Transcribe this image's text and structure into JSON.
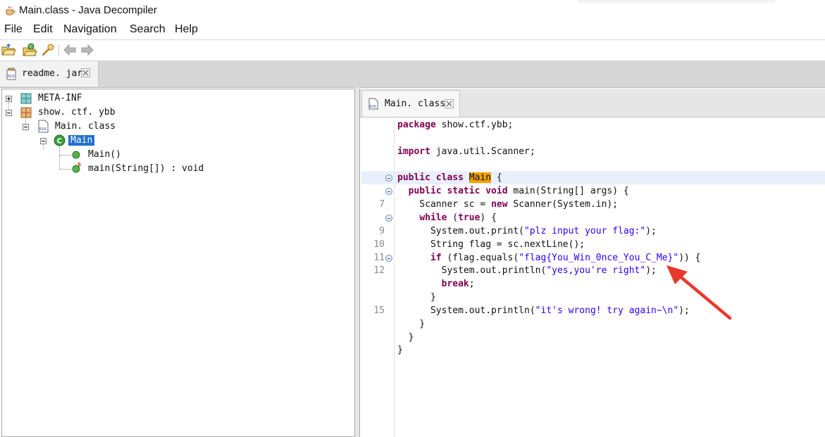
{
  "window": {
    "title": "Main.class - Java Decompiler"
  },
  "menu": [
    "File",
    "Edit",
    "Navigation",
    "Search",
    "Help"
  ],
  "toolbar": {
    "buttons": [
      "open-file-icon",
      "open-type-icon",
      "search-icon",
      "back-arrow-icon",
      "forward-arrow-icon"
    ]
  },
  "outer_tab": {
    "label": "readme. jar"
  },
  "tree": {
    "nodes": [
      {
        "label": "META-INF",
        "icon": "package-icon"
      },
      {
        "label": "show. ctf. ybb",
        "icon": "package-icon"
      },
      {
        "label": "Main. class",
        "icon": "class-file-icon"
      },
      {
        "label": "Main",
        "icon": "class-icon"
      },
      {
        "label": "Main()",
        "icon": "method-icon"
      },
      {
        "label": "main(String[]) : void",
        "icon": "static-method-icon"
      }
    ]
  },
  "editor": {
    "tab_label": "Main. class",
    "lines": [
      {
        "num": "",
        "fold": false,
        "current": false,
        "parts": [
          [
            "k",
            "package"
          ],
          [
            "t",
            " show.ctf.ybb;"
          ]
        ]
      },
      {
        "num": "",
        "fold": false,
        "current": false,
        "parts": []
      },
      {
        "num": "",
        "fold": false,
        "current": false,
        "parts": [
          [
            "k",
            "import"
          ],
          [
            "t",
            " java.util.Scanner;"
          ]
        ]
      },
      {
        "num": "",
        "fold": false,
        "current": false,
        "parts": []
      },
      {
        "num": "",
        "fold": true,
        "current": true,
        "parts": [
          [
            "k",
            "public class"
          ],
          [
            "t",
            " "
          ],
          [
            "h",
            "Main"
          ],
          [
            "t",
            " {"
          ]
        ]
      },
      {
        "num": "",
        "fold": true,
        "current": false,
        "parts": [
          [
            "t",
            "  "
          ],
          [
            "k",
            "public static void"
          ],
          [
            "t",
            " main(String[] args) {"
          ]
        ]
      },
      {
        "num": "7",
        "fold": false,
        "current": false,
        "parts": [
          [
            "t",
            "    Scanner sc = "
          ],
          [
            "k",
            "new"
          ],
          [
            "t",
            " Scanner(System.in);"
          ]
        ]
      },
      {
        "num": "",
        "fold": true,
        "current": false,
        "parts": [
          [
            "t",
            "    "
          ],
          [
            "k",
            "while"
          ],
          [
            "t",
            " ("
          ],
          [
            "k",
            "true"
          ],
          [
            "t",
            ") {"
          ]
        ]
      },
      {
        "num": "9",
        "fold": false,
        "current": false,
        "parts": [
          [
            "t",
            "      System.out.print("
          ],
          [
            "s",
            "\"plz input your flag:\""
          ],
          [
            "t",
            ");"
          ]
        ]
      },
      {
        "num": "10",
        "fold": false,
        "current": false,
        "parts": [
          [
            "t",
            "      String flag = sc.nextLine();"
          ]
        ]
      },
      {
        "num": "11",
        "fold": true,
        "current": false,
        "parts": [
          [
            "t",
            "      "
          ],
          [
            "k",
            "if"
          ],
          [
            "t",
            " (flag.equals("
          ],
          [
            "s",
            "\"flag{You_Win_0nce_You_C_Me}\""
          ],
          [
            "t",
            ")) {"
          ]
        ]
      },
      {
        "num": "12",
        "fold": false,
        "current": false,
        "parts": [
          [
            "t",
            "        System.out.println("
          ],
          [
            "s",
            "\"yes,you're right\""
          ],
          [
            "t",
            ");"
          ]
        ]
      },
      {
        "num": "",
        "fold": false,
        "current": false,
        "parts": [
          [
            "t",
            "        "
          ],
          [
            "k",
            "break"
          ],
          [
            "t",
            ";"
          ]
        ]
      },
      {
        "num": "",
        "fold": false,
        "current": false,
        "parts": [
          [
            "t",
            "      }"
          ]
        ]
      },
      {
        "num": "15",
        "fold": false,
        "current": false,
        "parts": [
          [
            "t",
            "      System.out.println("
          ],
          [
            "s",
            "\"it's wrong! try again~\\n\""
          ],
          [
            "t",
            ");"
          ]
        ]
      },
      {
        "num": "",
        "fold": false,
        "current": false,
        "parts": [
          [
            "t",
            "    }"
          ]
        ]
      },
      {
        "num": "",
        "fold": false,
        "current": false,
        "parts": [
          [
            "t",
            "  }"
          ]
        ]
      },
      {
        "num": "",
        "fold": false,
        "current": false,
        "parts": [
          [
            "t",
            "}"
          ]
        ]
      }
    ]
  },
  "colors": {
    "keyword": "#7f0055",
    "string": "#2a00ff",
    "selection": "#1f6fd0",
    "highlight": "#f5a000",
    "annotation_arrow": "#e8392b"
  }
}
